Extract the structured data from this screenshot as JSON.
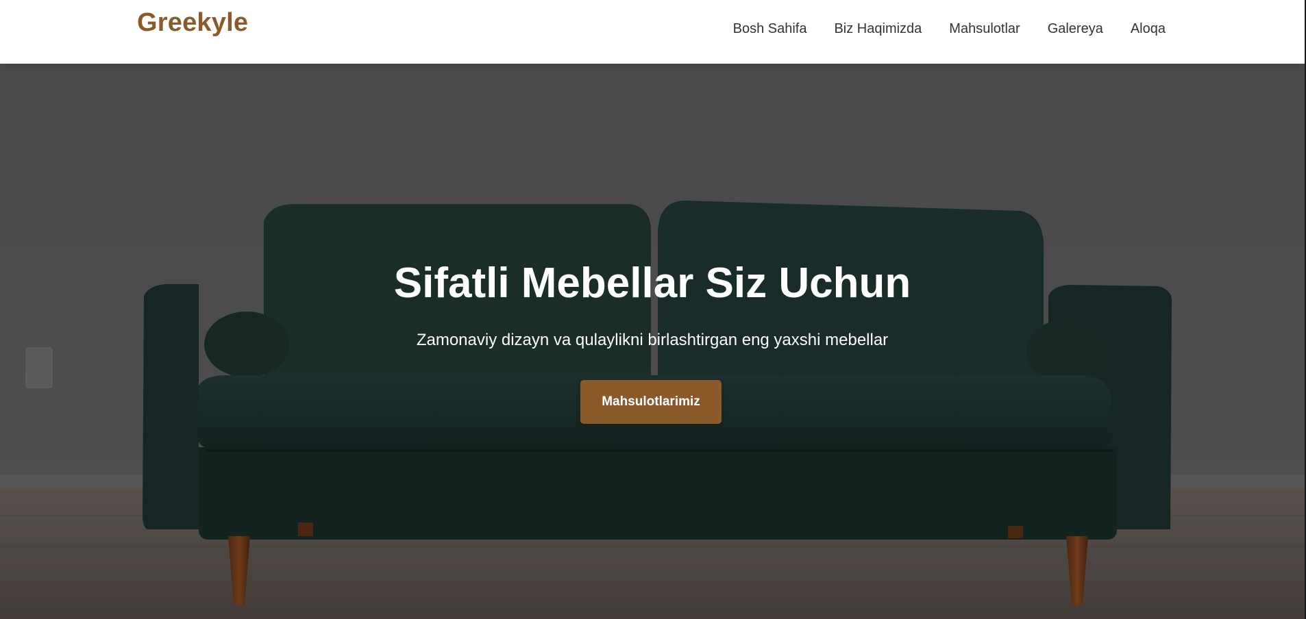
{
  "header": {
    "logo": "Greekyle",
    "nav": [
      {
        "label": "Bosh Sahifa"
      },
      {
        "label": "Biz Haqimizda"
      },
      {
        "label": "Mahsulotlar"
      },
      {
        "label": "Galereya"
      },
      {
        "label": "Aloqa"
      }
    ]
  },
  "hero": {
    "title": "Sifatli Mebellar Siz Uchun",
    "subtitle": "Zamonaviy dizayn va qulaylikni birlashtirgan eng yaxshi mebellar",
    "cta_label": "Mahsulotlarimiz",
    "image": "green-velvet-sofa-image"
  },
  "colors": {
    "brand": "#8b5a2b",
    "nav_text": "#333333",
    "hero_text": "#ffffff",
    "sofa": "#1c3330"
  }
}
